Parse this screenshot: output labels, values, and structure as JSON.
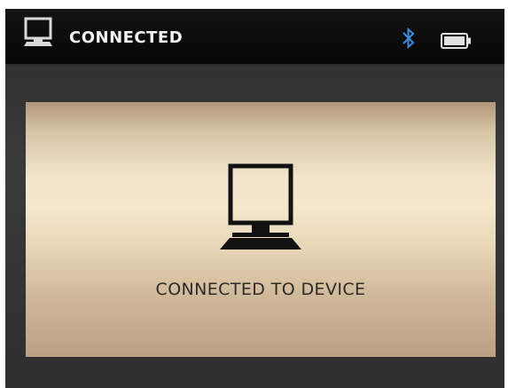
{
  "status_bar": {
    "title": "CONNECTED",
    "left_icon": "computer-icon",
    "right_icons": [
      "bluetooth-icon",
      "battery-icon"
    ],
    "bluetooth_color": "#3a8ee6"
  },
  "main": {
    "icon": "computer-icon",
    "message": "CONNECTED TO DEVICE"
  },
  "colors": {
    "status_bar_bg": "#0a0a0a",
    "frame_bg": "#333333",
    "panel_gradient_light": "#f4e7cc",
    "panel_gradient_dark": "#b2977a",
    "text_dark": "#2b2b2b",
    "text_light": "#f2f2f2"
  }
}
